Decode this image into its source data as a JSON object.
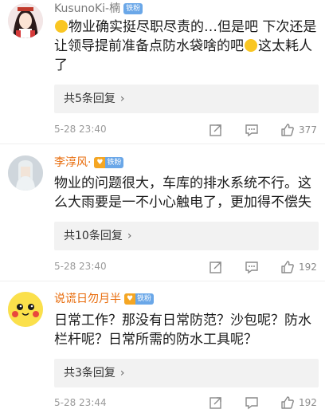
{
  "comments": [
    {
      "username": "KusunoKi-楠",
      "badge": "铁粉",
      "text_parts": [
        "物业确实挺尽职尽责的…但是吧 下次还是让领导提前准备点防水袋啥的吧",
        "这太耗人了"
      ],
      "replies_label": "共5条回复",
      "time": "5-28 23:40",
      "likes": "377"
    },
    {
      "username": "李淳风·",
      "badge": "铁粉",
      "text": "物业的问题很大，车库的排水系统不行。这么大雨要是一不小心触电了，更加得不偿失",
      "replies_label": "共10条回复",
      "time": "5-28 23:40",
      "likes": "192"
    },
    {
      "username": "说谎日勿月半",
      "badge": "铁粉",
      "text": "日常工作？那没有日常防范？沙包呢？防水栏杆呢？日常所需的防水工具呢？",
      "replies_label": "共3条回复",
      "time": "5-28 23:44",
      "likes": "192"
    }
  ],
  "icons": {
    "repost": "repost-icon",
    "reply": "comment-icon",
    "like": "thumbs-up-icon",
    "chevron": "chevron-right-icon"
  },
  "colors": {
    "username_orange": "#e86b0a",
    "username_gray": "#7a7a7a",
    "badge_blue": "#6aa7e8",
    "badge_gold": "#f5a623"
  }
}
